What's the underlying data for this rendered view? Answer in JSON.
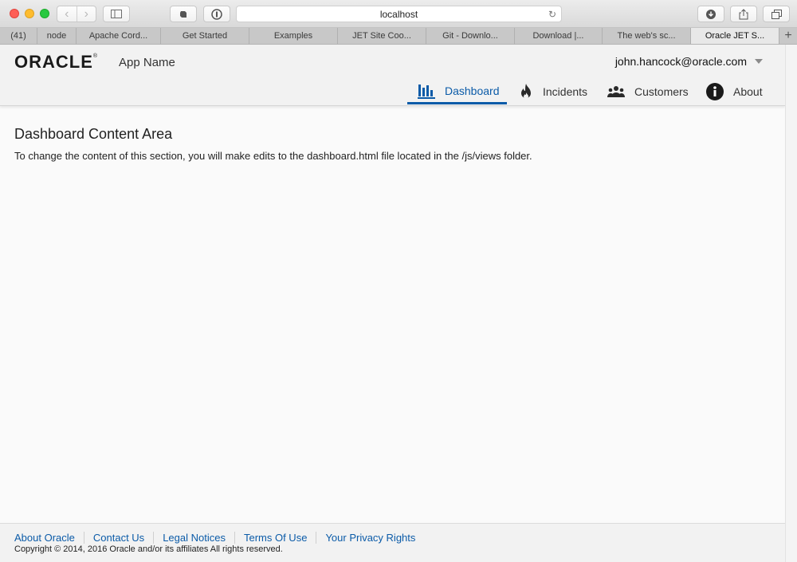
{
  "browser": {
    "url": "localhost",
    "tabs": [
      {
        "label": "(41)"
      },
      {
        "label": "node"
      },
      {
        "label": "Apache Cord..."
      },
      {
        "label": "Get Started"
      },
      {
        "label": "Examples"
      },
      {
        "label": "JET Site Coo..."
      },
      {
        "label": "Git - Downlo..."
      },
      {
        "label": "Download |..."
      },
      {
        "label": "The web's sc..."
      },
      {
        "label": "Oracle JET S...",
        "active": true
      }
    ]
  },
  "header": {
    "logo": "ORACLE",
    "logo_mark": "®",
    "app_name": "App Name",
    "user": "john.hancock@oracle.com"
  },
  "nav": [
    {
      "label": "Dashboard",
      "icon": "bar-chart-icon",
      "active": true
    },
    {
      "label": "Incidents",
      "icon": "fire-icon"
    },
    {
      "label": "Customers",
      "icon": "people-icon"
    },
    {
      "label": "About",
      "icon": "info-icon"
    }
  ],
  "content": {
    "title": "Dashboard Content Area",
    "body": "To change the content of this section, you will make edits to the dashboard.html file located in the /js/views folder."
  },
  "footer": {
    "links": [
      "About Oracle",
      "Contact Us",
      "Legal Notices",
      "Terms Of Use",
      "Your Privacy Rights"
    ],
    "copyright": "Copyright © 2014, 2016 Oracle and/or its affiliates All rights reserved."
  },
  "colors": {
    "accent": "#0b5ba8",
    "header_bg": "#f2f2f2",
    "page_bg": "#fafafa"
  }
}
